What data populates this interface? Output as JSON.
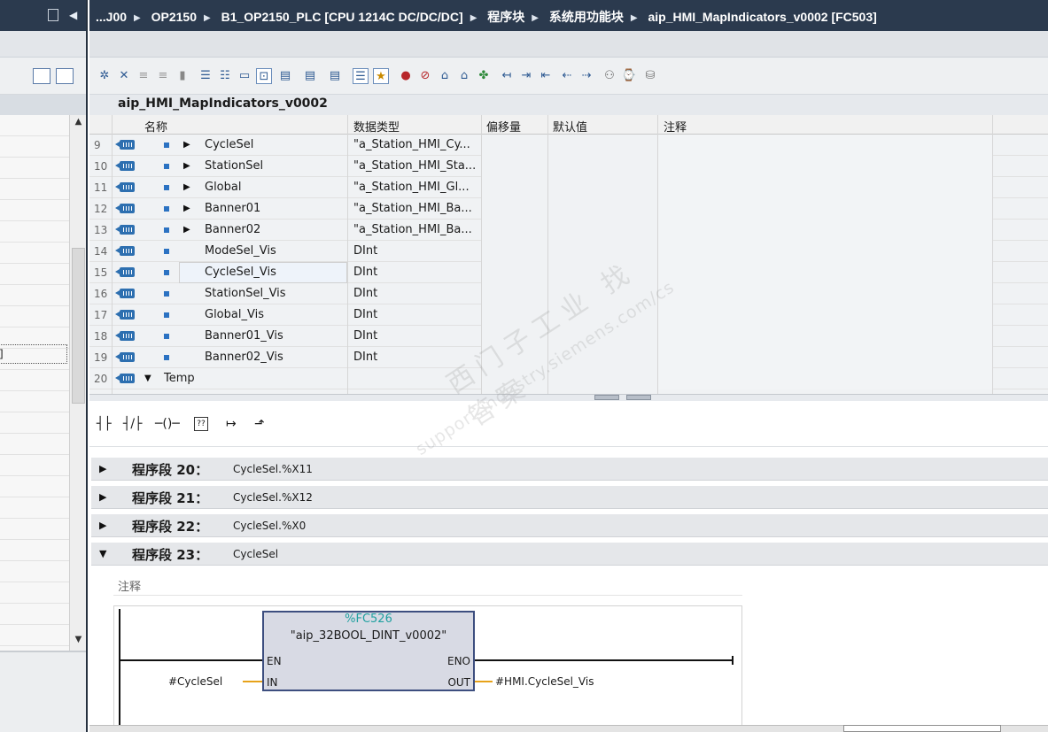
{
  "breadcrumb": {
    "items": [
      "...J00",
      "OP2150",
      "B1_OP2150_PLC [CPU 1214C DC/DC/DC]",
      "程序块",
      "系统用功能块",
      "aip_HMI_MapIndicators_v0002 [FC503]"
    ]
  },
  "left_panel": {
    "partial_text": "]"
  },
  "block_title": "aip_HMI_MapIndicators_v0002",
  "interface": {
    "columns": [
      "名称",
      "数据类型",
      "偏移量",
      "默认值",
      "注释"
    ],
    "rows": [
      {
        "num": "9",
        "name": "CycleSel",
        "type": "\"a_Station_HMI_Cy...",
        "expandable": true
      },
      {
        "num": "10",
        "name": "StationSel",
        "type": "\"a_Station_HMI_Sta...",
        "expandable": true
      },
      {
        "num": "11",
        "name": "Global",
        "type": "\"a_Station_HMI_Gl...",
        "expandable": true
      },
      {
        "num": "12",
        "name": "Banner01",
        "type": "\"a_Station_HMI_Ba...",
        "expandable": true
      },
      {
        "num": "13",
        "name": "Banner02",
        "type": "\"a_Station_HMI_Ba...",
        "expandable": true
      },
      {
        "num": "14",
        "name": "ModeSel_Vis",
        "type": "DInt",
        "expandable": false
      },
      {
        "num": "15",
        "name": "CycleSel_Vis",
        "type": "DInt",
        "expandable": false
      },
      {
        "num": "16",
        "name": "StationSel_Vis",
        "type": "DInt",
        "expandable": false
      },
      {
        "num": "17",
        "name": "Global_Vis",
        "type": "DInt",
        "expandable": false
      },
      {
        "num": "18",
        "name": "Banner01_Vis",
        "type": "DInt",
        "expandable": false
      },
      {
        "num": "19",
        "name": "Banner02_Vis",
        "type": "DInt",
        "expandable": false
      },
      {
        "num": "20",
        "name": "Temp",
        "type": "",
        "expandable": true
      }
    ]
  },
  "networks": [
    {
      "title": "程序段 20：",
      "comment": "CycleSel.%X11",
      "expanded": false
    },
    {
      "title": "程序段 21：",
      "comment": "CycleSel.%X12",
      "expanded": false
    },
    {
      "title": "程序段 22：",
      "comment": "CycleSel.%X0",
      "expanded": false
    },
    {
      "title": "程序段 23：",
      "comment": "CycleSel",
      "expanded": true
    }
  ],
  "network_comment": "注释",
  "function_block": {
    "number": "%FC526",
    "name": "\"aip_32BOOL_DINT_v0002\"",
    "en": "EN",
    "eno": "ENO",
    "in": "IN",
    "out": "OUT",
    "in_param": "#CycleSel",
    "out_param": "#HMI.CycleSel_Vis"
  },
  "watermark": {
    "line1": "西门子工业 找答案",
    "line2": "support.industry.siemens.com/cs"
  },
  "colors": {
    "title_bar": "#2b3a4e",
    "fc_number": "#20a0a0",
    "connection_wire": "#e7a21a",
    "block_fill": "#d8dae4"
  }
}
